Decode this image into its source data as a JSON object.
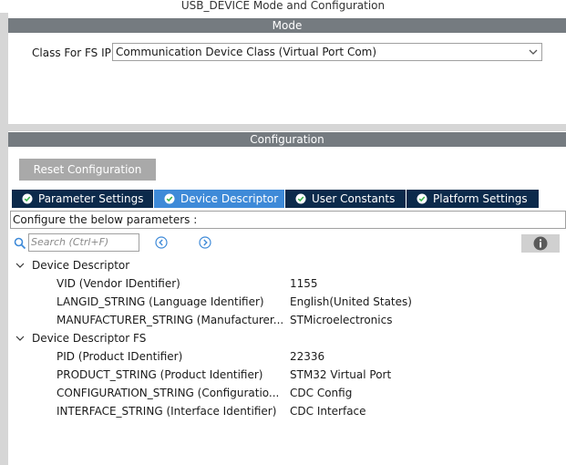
{
  "window": {
    "title": "USB_DEVICE Mode and Configuration"
  },
  "mode": {
    "header": "Mode",
    "class_label": "Class For FS IP",
    "class_value": "Communication Device Class (Virtual Port Com)"
  },
  "configuration": {
    "header": "Configuration",
    "reset_label": "Reset Configuration",
    "tabs": [
      {
        "label": "Parameter Settings",
        "active": false
      },
      {
        "label": "Device Descriptor",
        "active": true
      },
      {
        "label": "User Constants",
        "active": false
      },
      {
        "label": "Platform Settings",
        "active": false
      }
    ],
    "configure_text": "Configure the below parameters :",
    "search_placeholder": "Search (Ctrl+F)"
  },
  "tree": [
    {
      "group": "Device Descriptor",
      "items": [
        {
          "name": "VID (Vendor IDentifier)",
          "value": "1155"
        },
        {
          "name": "LANGID_STRING (Language Identifier)",
          "value": "English(United States)"
        },
        {
          "name": "MANUFACTURER_STRING (Manufacturer...",
          "value": "STMicroelectronics"
        }
      ]
    },
    {
      "group": "Device Descriptor FS",
      "items": [
        {
          "name": "PID (Product IDentifier)",
          "value": "22336"
        },
        {
          "name": "PRODUCT_STRING (Product Identifier)",
          "value": "STM32 Virtual Port"
        },
        {
          "name": "CONFIGURATION_STRING (Configuratio...",
          "value": "CDC Config"
        },
        {
          "name": "INTERFACE_STRING (Interface Identifier)",
          "value": "CDC Interface"
        }
      ]
    }
  ],
  "colors": {
    "section_header": "#757b80",
    "tab_inactive": "#0c2a4b",
    "tab_active": "#3e8ad8",
    "accent_icon": "#3e8ad8",
    "tab_check_icon": "#39b54a"
  },
  "icons": {
    "tab": "check-circle-icon",
    "search": "search-icon",
    "prev": "arrow-left-circle-icon",
    "next": "arrow-right-circle-icon",
    "info": "info-icon",
    "dropdown": "chevron-down-icon",
    "tree": "caret-down-icon"
  }
}
